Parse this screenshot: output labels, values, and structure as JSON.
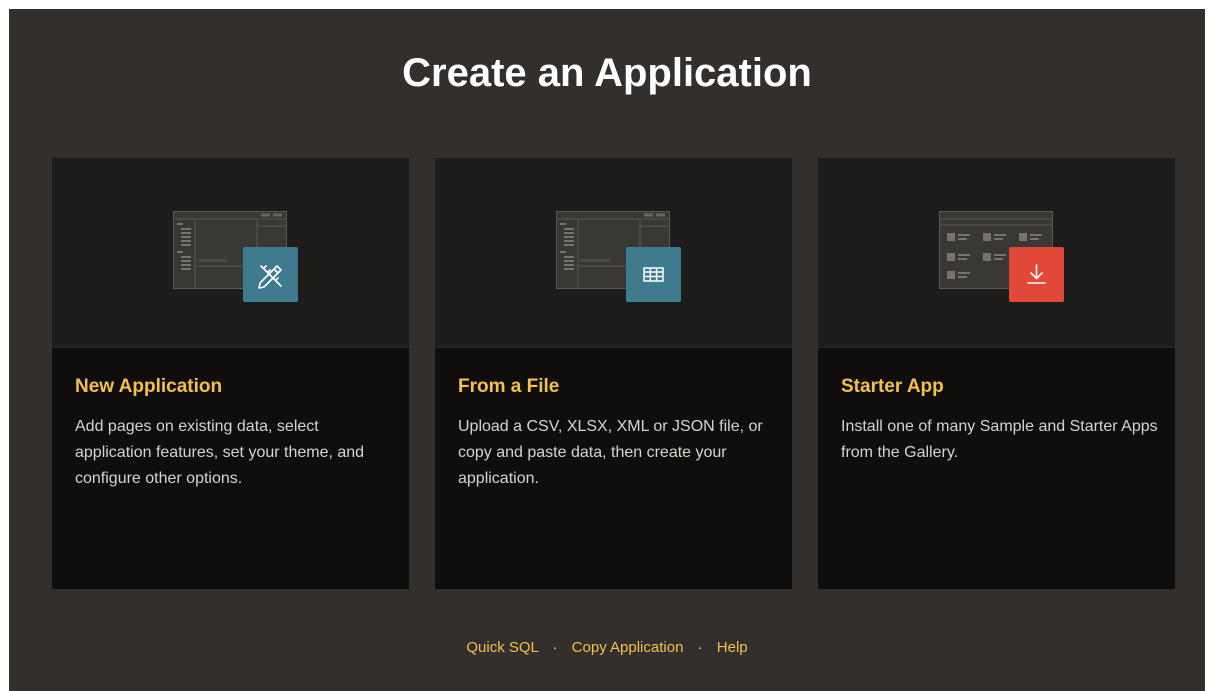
{
  "dialog": {
    "title": "Create an Application"
  },
  "cards": [
    {
      "title": "New Application",
      "description": "Add pages on existing data, select application features, set your theme, and configure other options.",
      "icon": "pencil-ruler-icon",
      "accent": "#3e7b8e"
    },
    {
      "title": "From a File",
      "description": "Upload a CSV, XLSX, XML or JSON file, or copy and paste data, then create your application.",
      "icon": "table-grid-icon",
      "accent": "#3e7b8e"
    },
    {
      "title": "Starter App",
      "description": "Install one of many Sample and Starter Apps from the Gallery.",
      "icon": "download-icon",
      "accent": "#e2483a"
    }
  ],
  "footer": {
    "links": [
      "Quick SQL",
      "Copy Application",
      "Help"
    ],
    "separator": "·"
  },
  "colors": {
    "background": "#322f2c",
    "card": "#0f0e0d",
    "card_header": "#1e1d1c",
    "link": "#f5c04a"
  }
}
